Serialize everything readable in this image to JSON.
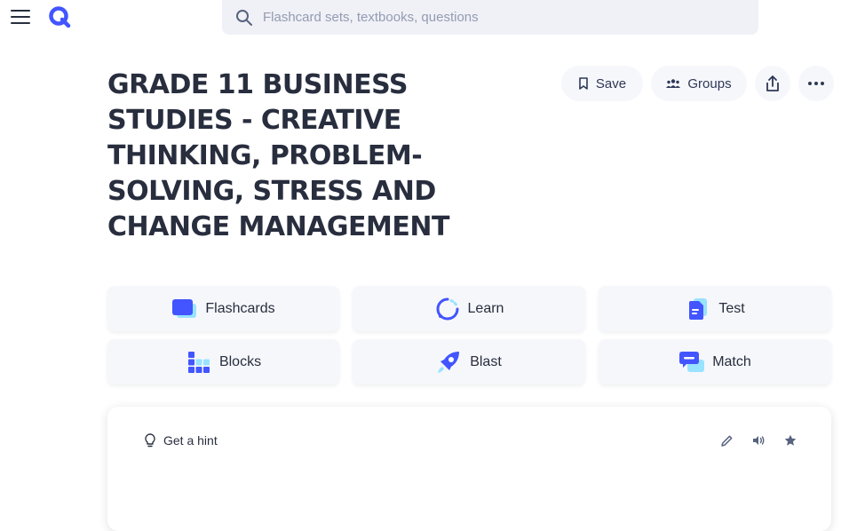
{
  "search": {
    "placeholder": "Flashcard sets, textbooks, questions"
  },
  "set": {
    "title": "GRADE 11 BUSINESS STUDIES - CREATIVE THINKING, PROBLEM-SOLVING, STRESS AND CHANGE MANAGEMENT"
  },
  "actions": {
    "save_label": "Save",
    "groups_label": "Groups"
  },
  "modes": [
    {
      "label": "Flashcards",
      "icon": "flashcards-icon"
    },
    {
      "label": "Learn",
      "icon": "learn-icon"
    },
    {
      "label": "Test",
      "icon": "test-icon"
    },
    {
      "label": "Blocks",
      "icon": "blocks-icon"
    },
    {
      "label": "Blast",
      "icon": "blast-icon"
    },
    {
      "label": "Match",
      "icon": "match-icon"
    }
  ],
  "card": {
    "hint_label": "Get a hint"
  },
  "colors": {
    "brand": "#4255ff",
    "accent_light": "#98e3ff",
    "text": "#282e3e",
    "muted": "#939bb4"
  }
}
